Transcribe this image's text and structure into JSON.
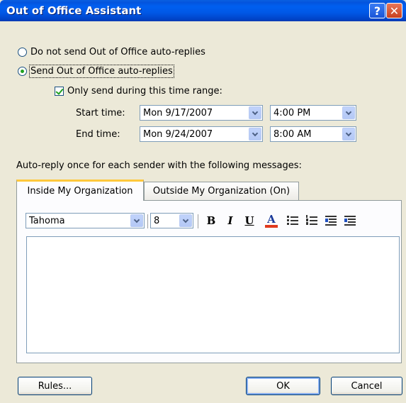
{
  "window": {
    "title": "Out of Office Assistant"
  },
  "titlebar": {
    "help_glyph": "?",
    "close_glyph": "✕"
  },
  "options": {
    "do_not_send_label": "Do not send Out of Office auto-replies",
    "send_label": "Send Out of Office auto-replies",
    "only_time_range_label": "Only send during this time range:"
  },
  "time_range": {
    "start_label": "Start time:",
    "end_label": "End time:",
    "start_date": "Mon 9/17/2007",
    "start_time": "4:00 PM",
    "end_date": "Mon 9/24/2007",
    "end_time": "8:00 AM"
  },
  "messages_label": "Auto-reply once for each sender with the following messages:",
  "tabs": [
    {
      "label": "Inside My Organization",
      "active": true
    },
    {
      "label": "Outside My Organization (On)",
      "active": false
    }
  ],
  "toolbar": {
    "font": "Tahoma",
    "size": "8",
    "bold": "B",
    "italic": "I",
    "underline": "U",
    "font_color": "A"
  },
  "buttons": {
    "rules": "Rules...",
    "ok": "OK",
    "cancel": "Cancel"
  },
  "colors": {
    "title_bar": "#0058E6",
    "active_tab_accent": "#FFC83C",
    "font_color_bar": "#E03A1E",
    "dialog_bg": "#ECE9D8"
  }
}
